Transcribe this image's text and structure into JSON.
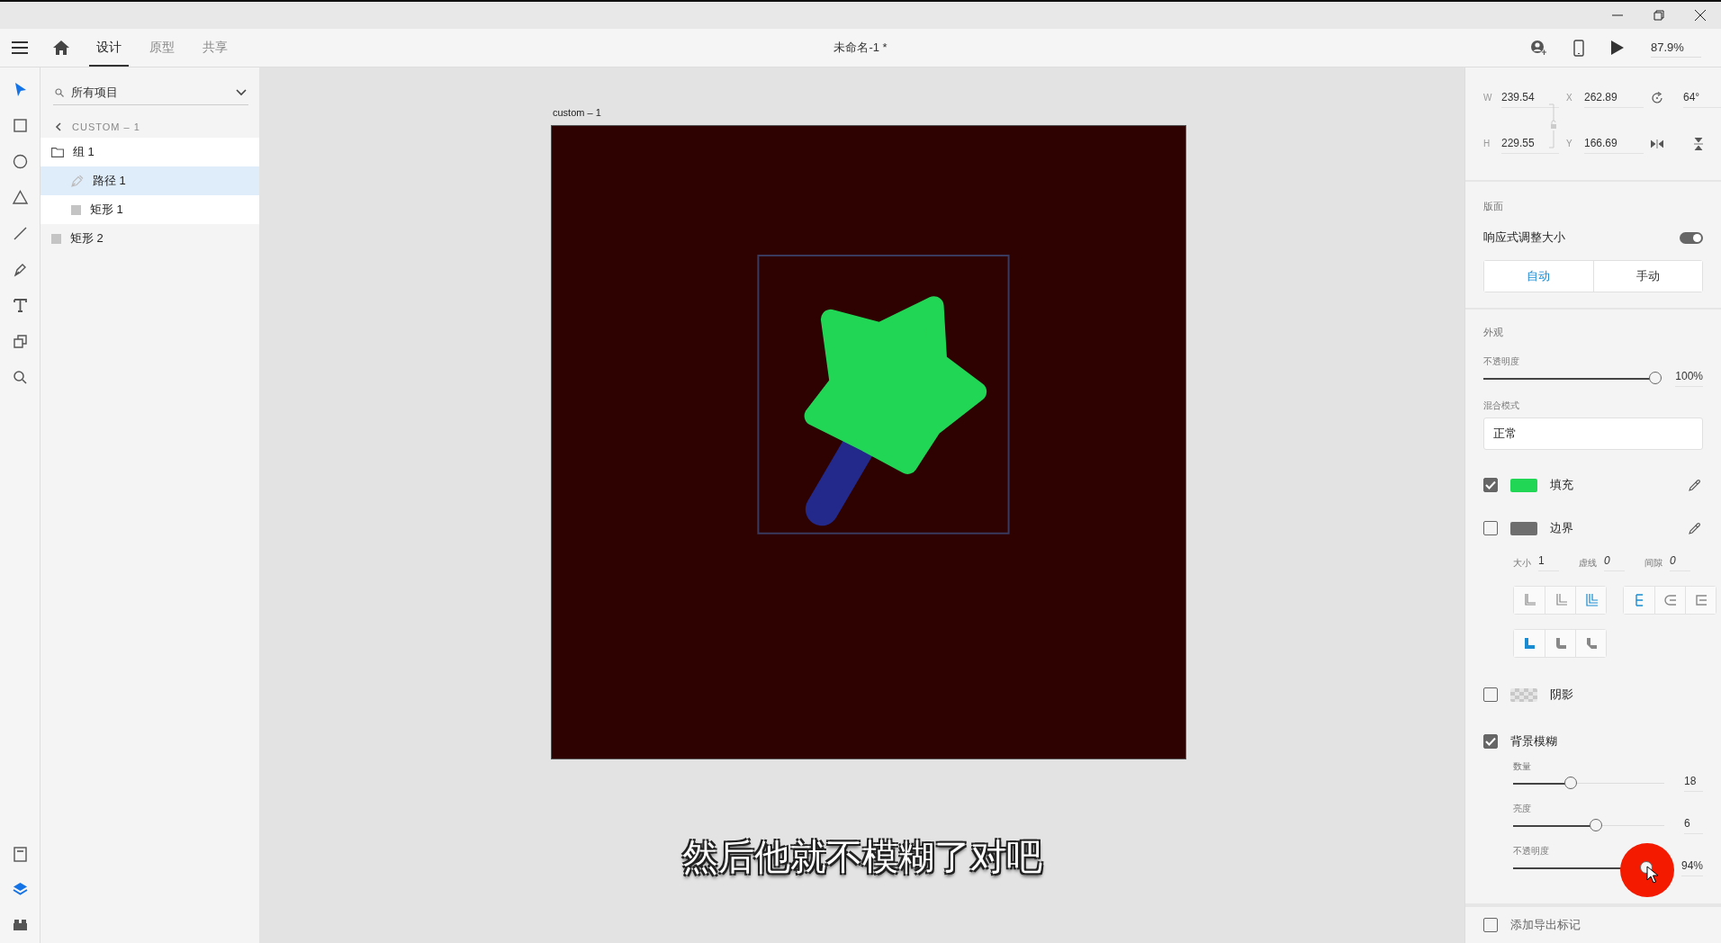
{
  "window": {
    "title": "未命名-1 *",
    "zoom": "87.9%"
  },
  "tabs": [
    {
      "label": "设计",
      "selected": true
    },
    {
      "label": "原型",
      "selected": false
    },
    {
      "label": "共享",
      "selected": false
    }
  ],
  "tools": [
    {
      "selected": true
    },
    {
      "selected": false
    },
    {
      "selected": false
    },
    {
      "selected": false
    },
    {
      "selected": false
    },
    {
      "selected": false
    },
    {
      "selected": false
    },
    {
      "selected": false
    },
    {
      "selected": false
    }
  ],
  "panel_switch": [
    {
      "selected": false
    },
    {
      "selected": true
    },
    {
      "selected": false
    }
  ],
  "layers_panel": {
    "search": {
      "placeholder": "所有项目"
    },
    "breadcrumb": "CUSTOM – 1",
    "items": [
      {
        "kind": "group",
        "name": "组 1",
        "selected": false,
        "expanded": true,
        "children": [
          {
            "kind": "path",
            "name": "路径 1",
            "selected": true
          },
          {
            "kind": "rect",
            "name": "矩形 1",
            "selected": false
          }
        ]
      },
      {
        "kind": "rect",
        "name": "矩形 2",
        "selected": false
      }
    ]
  },
  "canvas": {
    "artboard_label": "custom – 1"
  },
  "properties": {
    "transform": [
      {
        "label": "W",
        "value": "239.54"
      },
      {
        "label": "X",
        "value": "262.89"
      },
      {
        "label": "H",
        "value": "229.55"
      },
      {
        "label": "Y",
        "value": "166.69"
      }
    ],
    "rotation": "64°",
    "layout": {
      "heading": "版面",
      "responsive_label": "响应式调整大小",
      "responsive_on": true,
      "modes": [
        {
          "label": "自动",
          "selected": true
        },
        {
          "label": "手动",
          "selected": false
        }
      ]
    },
    "appearance": {
      "heading": "外观",
      "opacity": {
        "label": "不透明度",
        "level": 1,
        "reading": "100%"
      },
      "blend": {
        "label": "混合模式",
        "value": "正常"
      }
    },
    "fill": {
      "checked": true,
      "color": "#22d655",
      "label": "填充"
    },
    "border": {
      "checked": false,
      "color": "#6e6e6e",
      "label": "边界",
      "size_label": "大小",
      "size": "1",
      "dash_label": "虚线",
      "dash": "0",
      "gap_label": "间隙",
      "gap": "0"
    },
    "stroke_position": [
      {
        "selected": false
      },
      {
        "selected": false
      },
      {
        "selected": true
      }
    ],
    "stroke_cap": [
      {
        "selected": true
      },
      {
        "selected": false
      },
      {
        "selected": false
      }
    ],
    "stroke_join": [
      {
        "selected": true
      },
      {
        "selected": false
      },
      {
        "selected": false
      }
    ],
    "shadow": {
      "checked": false,
      "label": "阴影"
    },
    "background_blur": {
      "checked": true,
      "label": "背景模糊",
      "sliders": [
        {
          "label": "数量",
          "level": 0.38,
          "reading": "18"
        },
        {
          "label": "亮度",
          "level": 0.55,
          "reading": "6"
        },
        {
          "label": "不透明度",
          "level": 0.9,
          "reading": "94%"
        }
      ]
    },
    "export_mark": {
      "checked": false,
      "label": "添加导出标记"
    }
  },
  "subtitle": "然后他就不模糊了对吧"
}
